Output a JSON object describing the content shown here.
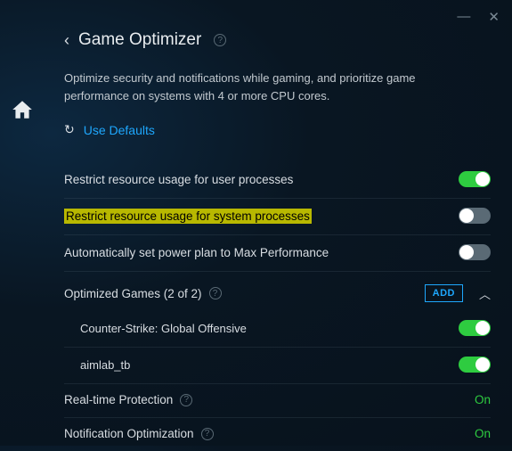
{
  "header": {
    "title": "Game Optimizer",
    "description": "Optimize security and notifications while gaming, and prioritize game performance on systems with 4 or more CPU cores."
  },
  "defaults": {
    "label": "Use Defaults"
  },
  "settings": {
    "restrict_user": {
      "label": "Restrict resource usage for user processes"
    },
    "restrict_system": {
      "label": "Restrict resource usage for system processes"
    },
    "power_plan": {
      "label": "Automatically set power plan to Max Performance"
    }
  },
  "games_section": {
    "label": "Optimized Games (2 of 2)",
    "add": "ADD",
    "items": [
      {
        "name": "Counter-Strike: Global Offensive"
      },
      {
        "name": "aimlab_tb"
      }
    ]
  },
  "status": {
    "realtime": {
      "label": "Real-time Protection",
      "value": "On"
    },
    "notification": {
      "label": "Notification Optimization",
      "value": "On"
    }
  }
}
